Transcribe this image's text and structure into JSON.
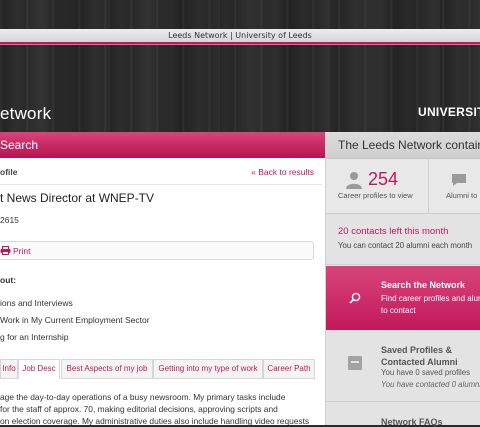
{
  "window": {
    "title": "Leeds Network | University of Leeds"
  },
  "branding": {
    "left_text": "etwork",
    "right_text": "UNIVERSITY"
  },
  "left": {
    "header": "Search",
    "profile_label": "ofile",
    "back_link": "« Back to results",
    "job_title": "t News Director at WNEP-TV",
    "job_id": "2615",
    "print_label": "Print",
    "about_heading": "out:",
    "about_items": [
      "ions and Interviews",
      "Work in My Current Employment Sector",
      "g for an Internship"
    ],
    "tabs": [
      "Info",
      "Job Desc",
      "Best Aspects of my job",
      "Getting into my type of work",
      "Career Path"
    ],
    "active_tab": "Job Desc",
    "description_lines": [
      "age the day-to-day operations of a busy newsroom. My primary tasks include",
      "for the staff of approx. 70, making editorial decisions, approving scripts and",
      "on election coverage. My administrative duties also include handling video requests"
    ]
  },
  "right": {
    "header": "The Leeds Network contains",
    "stat1_value": "254",
    "stat1_label": "Career profiles to view",
    "stat2_label": "Alumni to",
    "contacts_title": "20 contacts left this month",
    "contacts_sub": "You can contact 20 alumni each month",
    "search_title": "Search the Network",
    "search_sub": "Find career profiles and alumni to contact",
    "saved_title": "Saved Profiles & Contacted Alumni",
    "saved_line1": "You have 0 saved profiles",
    "saved_line2": "You have contacted 0 alumni",
    "faqs": "Network FAQs"
  },
  "colors": {
    "accent": "#c2185b",
    "panel_gray": "#e3e3e3"
  }
}
